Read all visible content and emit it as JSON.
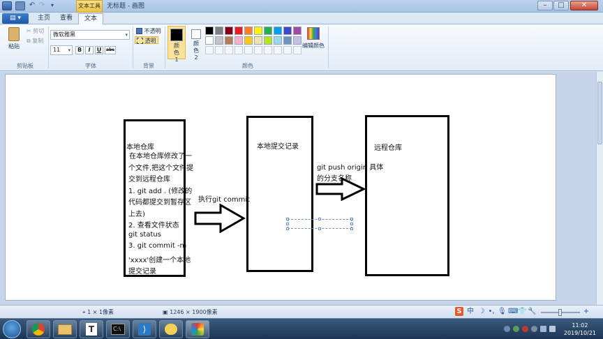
{
  "window": {
    "context_tab": "文本工具",
    "title": "无标题 - 画图",
    "min": "–",
    "max": "□",
    "close": "✕"
  },
  "tabs": {
    "file": "▾",
    "home": "主页",
    "view": "查看",
    "text": "文本"
  },
  "ribbon": {
    "clipboard": {
      "paste": "粘贴",
      "cut": "剪切",
      "copy": "复制",
      "label": "剪贴板"
    },
    "font": {
      "family": "微软雅黑",
      "size": "11",
      "bold": "B",
      "italic": "I",
      "underline": "U",
      "strike": "abc",
      "label": "字体"
    },
    "background": {
      "opaque": "不透明",
      "transparent": "透明",
      "label": "背景"
    },
    "colors": {
      "color1_label": "颜色 1",
      "color2_label": "颜色 2",
      "edit": "编辑颜色",
      "label": "颜色",
      "color1": "#000000",
      "color2": "#ffffff",
      "palette_row1": [
        "#000000",
        "#7f7f7f",
        "#880015",
        "#ed1c24",
        "#ff7f27",
        "#fff200",
        "#22b14c",
        "#00a2e8",
        "#3f48cc",
        "#a349a4"
      ],
      "palette_row2": [
        "#ffffff",
        "#c3c3c3",
        "#b97a57",
        "#ffaec9",
        "#ffc90e",
        "#efe4b0",
        "#b5e61d",
        "#99d9ea",
        "#7092be",
        "#c8bfe7"
      ]
    }
  },
  "canvas": {
    "box1": {
      "title": "本地仓库",
      "lines": [
        "在本地仓库修改了一",
        "个文件,把这个文件提",
        "交到远程仓库",
        "1. git add . (修改的",
        "代码都提交到暂存区",
        "上去)",
        "2. 查看文件状态",
        "git status",
        "3. git commit -m",
        "'xxxx'创建一个本地",
        "提交记录"
      ]
    },
    "arrow1_label": "执行git commit",
    "box2_title": "本地提交记录",
    "arrow2_label_1": "git push origin 具体",
    "arrow2_label_2": "的分支名称",
    "box3_title": "远程仓库"
  },
  "status": {
    "cursor_pos": "1 × 1像素",
    "image_size": "1246 × 1900像素",
    "zoom": "100%"
  },
  "taskbar": {
    "time": "11:02",
    "date": "2019/10/21"
  }
}
